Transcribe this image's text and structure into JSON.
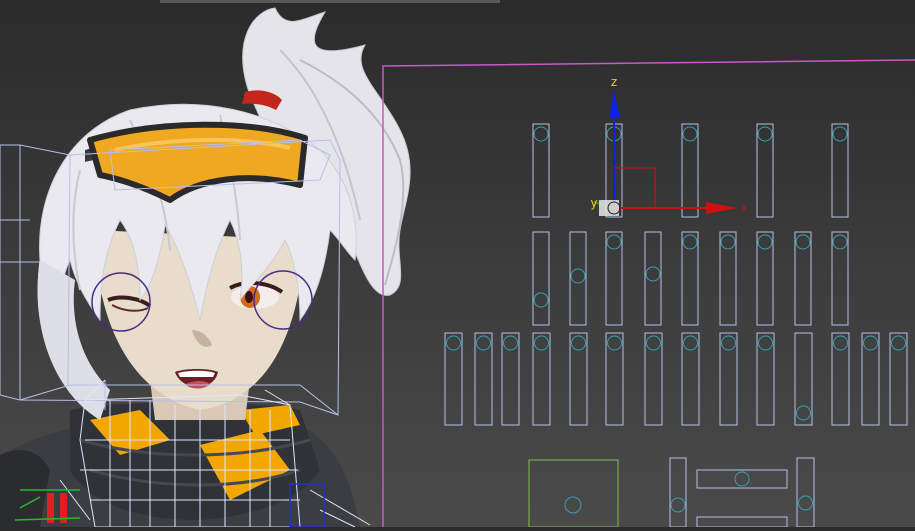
{
  "viewport": {
    "axis_labels": {
      "z": "z",
      "y": "y",
      "x": "x"
    },
    "colors": {
      "background_top": "#2b2b2b",
      "background_bottom": "#4a4a4a",
      "selection_bracket": "#c85ac8",
      "bone_outline": "#b8bfe8",
      "helper_circle": "#3aa0b0",
      "green_box": "#7ac04a",
      "axis_x": "#d01010",
      "axis_y": "#10a010",
      "axis_z": "#1020e0",
      "goggles": "#f0a820",
      "hair": "#e8e8ee",
      "scarf_yellow": "#f2a600",
      "eye_circle": "#4a2a8a"
    },
    "icons": [
      "character-model-icon",
      "transform-gizmo-icon",
      "facial-rig-controls-icon"
    ]
  }
}
